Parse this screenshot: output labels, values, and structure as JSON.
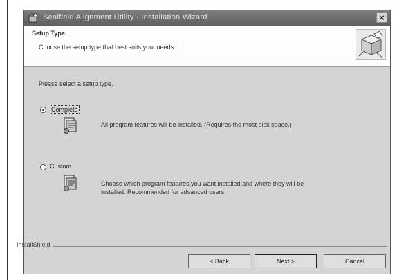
{
  "window": {
    "title": "Sealfield Alignment Utility - Installation Wizard",
    "close_glyph": "×"
  },
  "banner": {
    "heading": "Setup Type",
    "subheading": "Choose the setup type that best suits your needs."
  },
  "content": {
    "prompt": "Please select a setup type.",
    "options": [
      {
        "label": "Complete",
        "selected": true,
        "icon": "package-icon",
        "description": "All program features will be installed. (Requires the most disk space.)"
      },
      {
        "label": "Custom",
        "selected": false,
        "icon": "package-icon",
        "description": "Choose which program features you want installed and where they will be installed. Recommended for advanced users."
      }
    ]
  },
  "footer": {
    "group_label": "InstallShield",
    "back_label": "< Back",
    "next_label": "Next >",
    "cancel_label": "Cancel"
  },
  "colors": {
    "titlebar": "#6e6e6e",
    "window_bg": "#d4d4d4",
    "banner_bg": "#fdfdfd"
  }
}
